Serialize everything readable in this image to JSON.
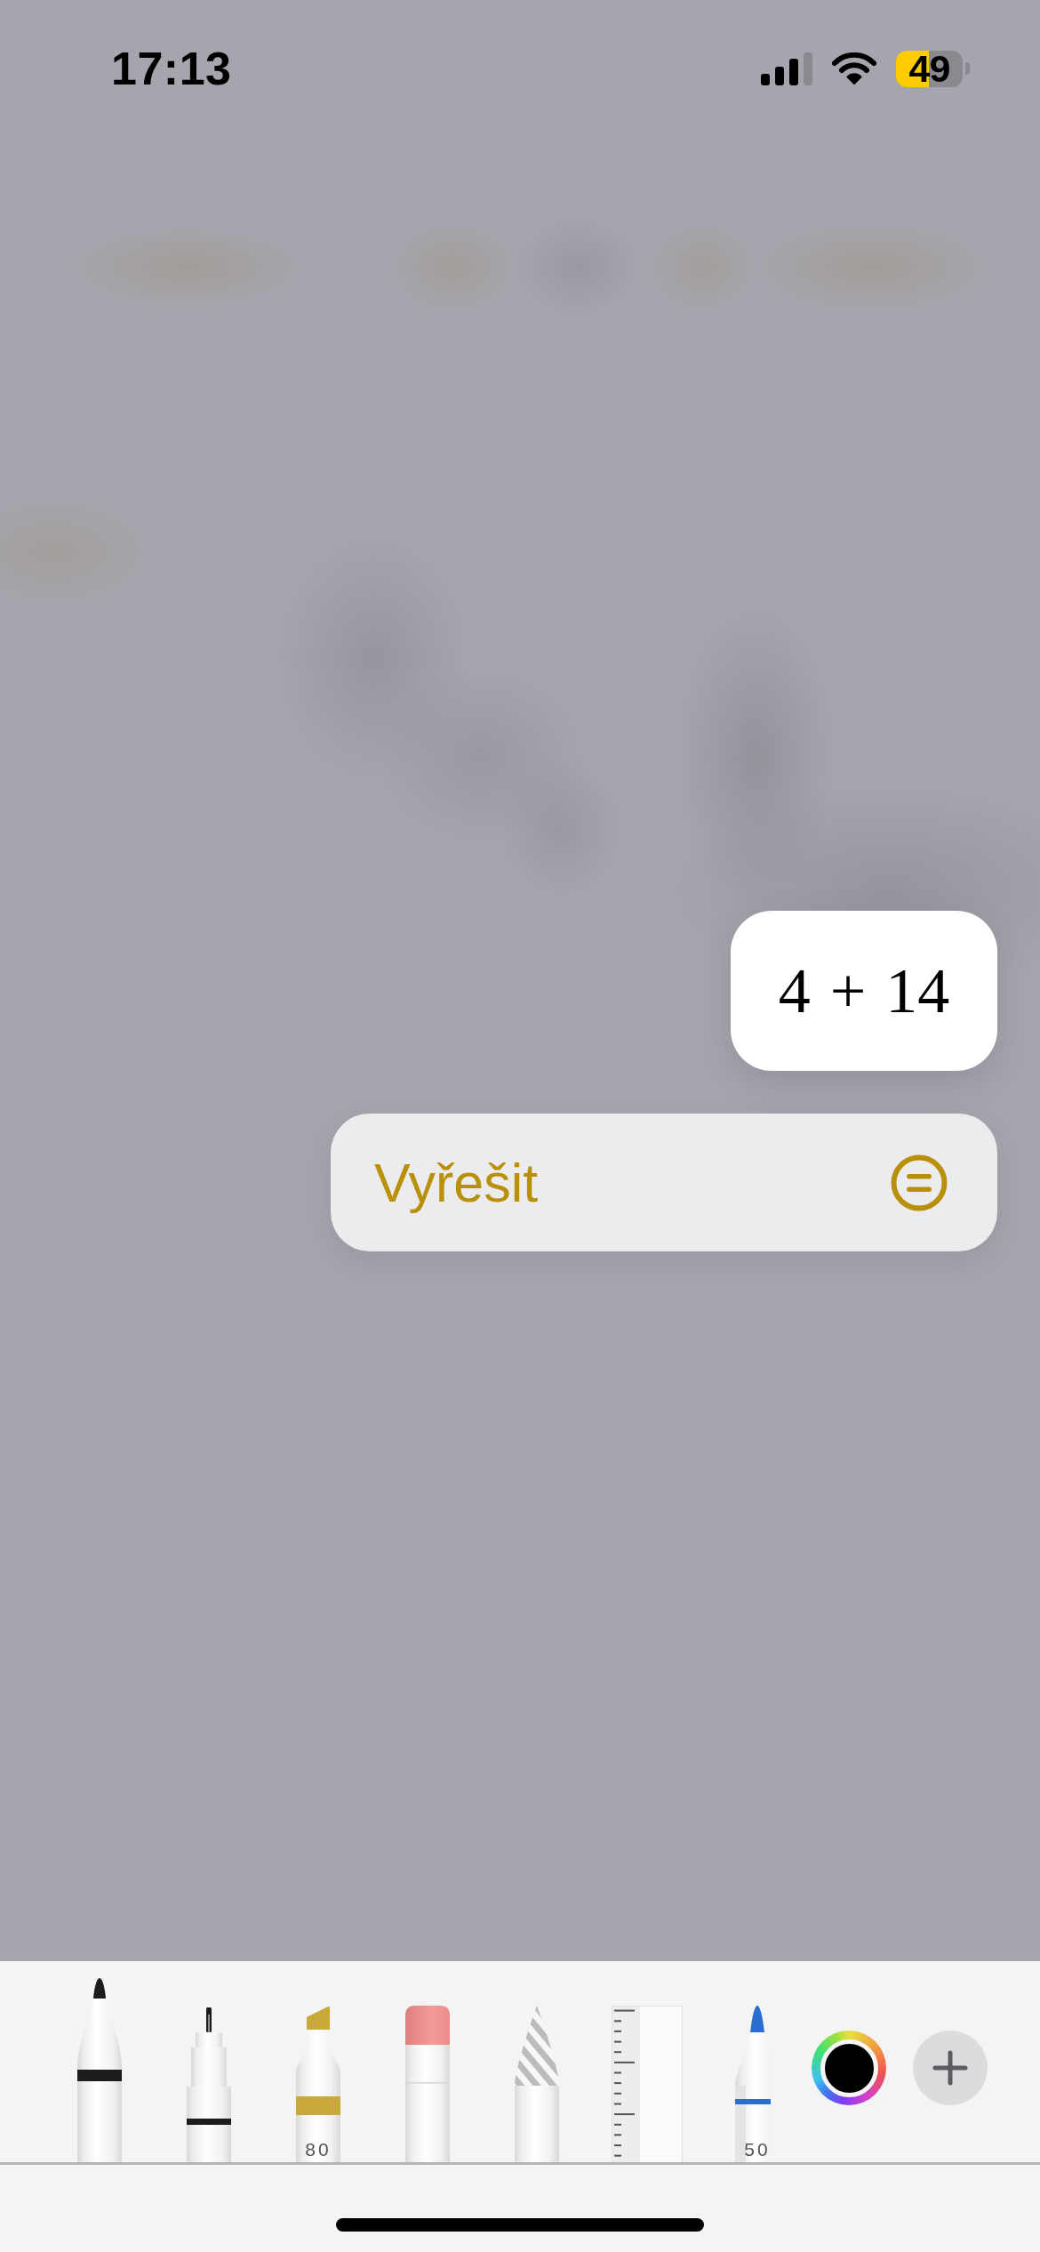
{
  "status_bar": {
    "time": "17:13",
    "battery": {
      "percent": "49",
      "low_power": true
    }
  },
  "math_result": {
    "expression": "4 + 14"
  },
  "solve_button": {
    "label": "Vyřešit"
  },
  "tool_palette": {
    "tools": [
      {
        "kind": "pen",
        "selected": true,
        "color": "#1c1c1e"
      },
      {
        "kind": "fineliner",
        "selected": false,
        "color": "#1c1c1e"
      },
      {
        "kind": "marker",
        "selected": false,
        "color": "#c9a93a",
        "label": "80"
      },
      {
        "kind": "eraser",
        "selected": false
      },
      {
        "kind": "lasso",
        "selected": false
      },
      {
        "kind": "ruler",
        "selected": false
      },
      {
        "kind": "pencil",
        "selected": false,
        "color": "#2a6fd0",
        "label": "50"
      }
    ],
    "color_picker": {
      "color": "#000000"
    }
  }
}
